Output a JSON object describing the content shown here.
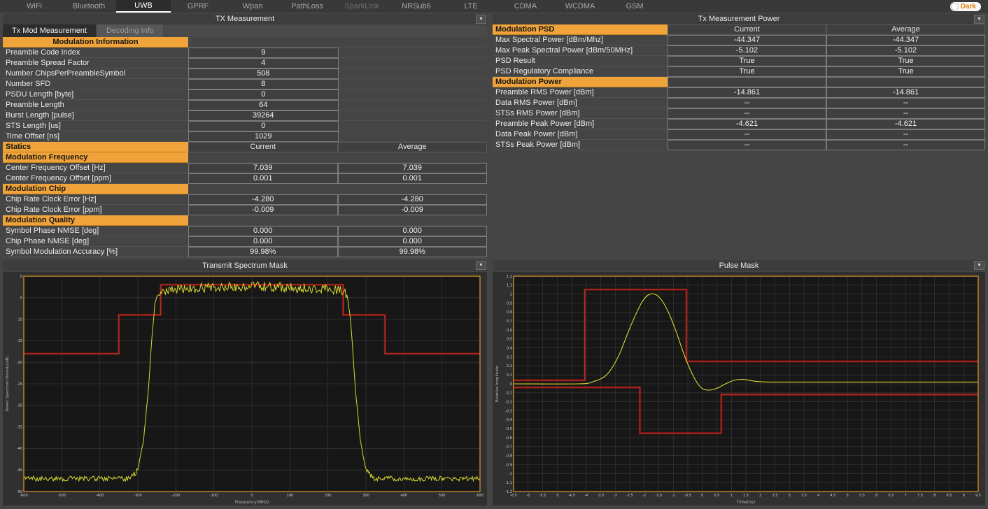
{
  "icons": {
    "collapse": "▼"
  },
  "colors": {
    "accent_orange": "#efa33a",
    "trace_yellow": "#d9d832",
    "mask_red": "#b03228",
    "mask_dark_red": "#6f120e",
    "chart_frame_orange": "#c8882a"
  },
  "tabbar": {
    "tabs": [
      {
        "label": "WiFi"
      },
      {
        "label": "Bluetooth"
      },
      {
        "label": "UWB"
      },
      {
        "label": "GPRF"
      },
      {
        "label": "Wpan"
      },
      {
        "label": "PathLoss"
      },
      {
        "label": "SparkLink"
      },
      {
        "label": "NRSub6"
      },
      {
        "label": "LTE"
      },
      {
        "label": "CDMA"
      },
      {
        "label": "WCDMA"
      },
      {
        "label": "GSM"
      }
    ],
    "active_tab": "UWB",
    "dark_toggle": {
      "label": "Dark"
    }
  },
  "left_panel": {
    "title": "TX Measurement",
    "tabs": [
      {
        "label": "Tx Mod Measurement"
      },
      {
        "label": "Decoding Info"
      }
    ],
    "info_section_title": "Modulation Information",
    "info_rows": [
      {
        "label": "Preamble Code Index",
        "value": "9"
      },
      {
        "label": "Preamble Spread Factor",
        "value": "4"
      },
      {
        "label": "Number ChipsPerPreambleSymbol",
        "value": "508"
      },
      {
        "label": "Number SFD",
        "value": "8"
      },
      {
        "label": "PSDU Length [byte]",
        "value": "0"
      },
      {
        "label": "Preamble Length",
        "value": "64"
      },
      {
        "label": "Burst Length [pulse]",
        "value": "39264"
      },
      {
        "label": "STS Length [us]",
        "value": "0"
      },
      {
        "label": "Time Offset [ns]",
        "value": "1029"
      }
    ],
    "statics": {
      "label": "Statics",
      "col_current": "Current",
      "col_average": "Average"
    },
    "sections": [
      {
        "title": "Modulation Frequency",
        "rows": [
          {
            "label": "Center Frequency Offset [Hz]",
            "current": "7.039",
            "average": "7.039"
          },
          {
            "label": "Center Frequency Offset [ppm]",
            "current": "0.001",
            "average": "0.001"
          }
        ]
      },
      {
        "title": "Modulation Chip",
        "rows": [
          {
            "label": "Chip Rate Clock Error [Hz]",
            "current": "-4.280",
            "average": "-4.280"
          },
          {
            "label": "Chip Rate Clock Error [ppm]",
            "current": "-0.009",
            "average": "-0.009"
          }
        ]
      },
      {
        "title": "Modulation Quality",
        "rows": [
          {
            "label": "Symbol Phase NMSE [deg]",
            "current": "0.000",
            "average": "0.000"
          },
          {
            "label": "Chip Phase NMSE [deg]",
            "current": "0.000",
            "average": "0.000"
          },
          {
            "label": "Symbol Modulation Accuracy [%]",
            "current": "99.98%",
            "average": "99.98%"
          }
        ]
      }
    ]
  },
  "right_panel": {
    "title": "Tx Measurement Power",
    "psd_section": {
      "title": "Modulation PSD",
      "col_current": "Current",
      "col_average": "Average"
    },
    "psd_rows": [
      {
        "label": "Max Spectral Power [dBm/Mhz]",
        "current": "-44.347",
        "average": "-44.347"
      },
      {
        "label": "Max Peak Spectral Power [dBm/50MHz]",
        "current": "-5.102",
        "average": "-5.102"
      },
      {
        "label": "PSD Result",
        "current": "True",
        "average": "True"
      },
      {
        "label": "PSD Regulatory Compliance",
        "current": "True",
        "average": "True"
      }
    ],
    "power_section": {
      "title": "Modulation Power"
    },
    "power_rows": [
      {
        "label": "Preamble RMS Power [dBm]",
        "current": "-14.861",
        "average": "-14.861"
      },
      {
        "label": "Data RMS Power [dBm]",
        "current": "--",
        "average": "--"
      },
      {
        "label": "STSs RMS Power [dBm]",
        "current": "--",
        "average": "--"
      },
      {
        "label": "Preamble Peak Power [dBm]",
        "current": "-4.621",
        "average": "-4.621"
      },
      {
        "label": "Data Peak Power [dBm]",
        "current": "--",
        "average": "--"
      },
      {
        "label": "STSs Peak Power [dBm]",
        "current": "--",
        "average": "--"
      }
    ]
  },
  "chart_data": [
    {
      "id": "transmit-spectrum-mask",
      "type": "line",
      "title": "Transmit Spectrum Mask",
      "xlabel": "Frequency(MHz)",
      "ylabel": "Power Spectrum Density(dB)",
      "xlim": [
        -600,
        600
      ],
      "xtick_step": 100,
      "ylim": [
        -50,
        0
      ],
      "ytick_step": 5,
      "grid": true,
      "legend": "none",
      "series": [
        {
          "name": "spectrum-mask-limit",
          "color": "#b03228",
          "shadow": "#6f120e",
          "width": 1.4,
          "points": [
            [
              -600,
              -18
            ],
            [
              -350,
              -18
            ],
            [
              -350,
              -9
            ],
            [
              -240,
              -9
            ],
            [
              -240,
              -2
            ],
            [
              240,
              -2
            ],
            [
              240,
              -9
            ],
            [
              350,
              -9
            ],
            [
              350,
              -18
            ],
            [
              600,
              -18
            ]
          ]
        },
        {
          "name": "measured-spectrum",
          "color": "#d9d832",
          "width": 1,
          "envelope": [
            [
              -600,
              -47
            ],
            [
              -320,
              -47
            ],
            [
              -300,
              -45
            ],
            [
              -285,
              -38
            ],
            [
              -272,
              -26
            ],
            [
              -262,
              -13
            ],
            [
              -255,
              -6.5
            ],
            [
              -248,
              -4
            ],
            [
              -235,
              -3.2
            ],
            [
              -200,
              -3.1
            ],
            [
              -150,
              -2.8
            ],
            [
              -100,
              -2.6
            ],
            [
              -60,
              -2.5
            ],
            [
              0,
              -2.3
            ],
            [
              60,
              -2.5
            ],
            [
              100,
              -2.6
            ],
            [
              150,
              -2.8
            ],
            [
              200,
              -3.1
            ],
            [
              235,
              -3.2
            ],
            [
              248,
              -4
            ],
            [
              255,
              -6.5
            ],
            [
              262,
              -13
            ],
            [
              272,
              -26
            ],
            [
              285,
              -38
            ],
            [
              300,
              -45
            ],
            [
              320,
              -47
            ],
            [
              600,
              -47
            ]
          ],
          "noise_amp_top": 1.1,
          "noise_amp_floor": 0.6,
          "noise_amp_slope": 0.25,
          "sample_step": 2.5
        }
      ]
    },
    {
      "id": "pulse-mask",
      "type": "line",
      "title": "Pulse Mask",
      "xlabel": "Time(ns)",
      "ylabel": "Relative Amplitude",
      "xlim": [
        -6.5,
        9.5
      ],
      "xtick_step": 0.5,
      "ylim": [
        -1.2,
        1.2
      ],
      "ytick_step": 0.1,
      "grid": true,
      "legend": "none",
      "series": [
        {
          "name": "upper-pulse-mask-limit",
          "color": "#b03228",
          "shadow": "#6f120e",
          "width": 1.4,
          "points": [
            [
              -6.5,
              0.04
            ],
            [
              -4.05,
              0.04
            ],
            [
              -4.05,
              1.05
            ],
            [
              -0.55,
              1.05
            ],
            [
              -0.55,
              0.25
            ],
            [
              9.5,
              0.25
            ]
          ]
        },
        {
          "name": "lower-pulse-mask-limit",
          "color": "#b03228",
          "shadow": "#6f120e",
          "width": 1.4,
          "points": [
            [
              -6.5,
              -0.04
            ],
            [
              -2.15,
              -0.04
            ],
            [
              -2.15,
              -0.55
            ],
            [
              0.65,
              -0.55
            ],
            [
              0.65,
              -0.12
            ],
            [
              9.5,
              -0.12
            ]
          ]
        },
        {
          "name": "measured-pulse",
          "color": "#d9d832",
          "width": 1.1,
          "smooth_points": [
            [
              -6.5,
              0
            ],
            [
              -4.3,
              0
            ],
            [
              -3.8,
              0.02
            ],
            [
              -3.3,
              0.1
            ],
            [
              -2.9,
              0.3
            ],
            [
              -2.5,
              0.62
            ],
            [
              -2.1,
              0.9
            ],
            [
              -1.8,
              1.0
            ],
            [
              -1.5,
              0.97
            ],
            [
              -1.2,
              0.82
            ],
            [
              -0.9,
              0.58
            ],
            [
              -0.6,
              0.3
            ],
            [
              -0.3,
              0.08
            ],
            [
              -0.05,
              -0.04
            ],
            [
              0.2,
              -0.07
            ],
            [
              0.5,
              -0.05
            ],
            [
              0.8,
              0
            ],
            [
              1.1,
              0.04
            ],
            [
              1.4,
              0.05
            ],
            [
              1.8,
              0.03
            ],
            [
              2.3,
              0.02
            ],
            [
              3.5,
              0.02
            ],
            [
              5.5,
              0.02
            ],
            [
              7.5,
              0.02
            ],
            [
              9.5,
              0.02
            ]
          ]
        }
      ]
    }
  ]
}
